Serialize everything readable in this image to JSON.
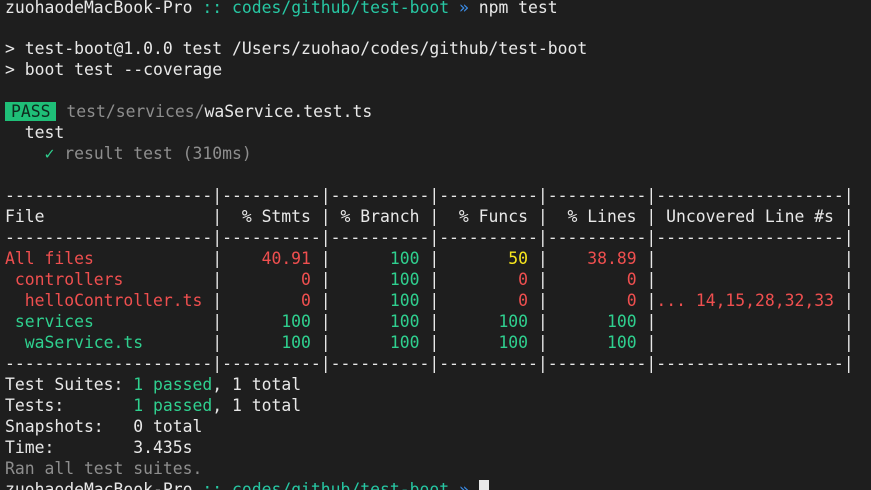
{
  "prompt": {
    "host": "zuohaodeMacBook-Pro",
    "sep": " :: ",
    "path": "codes/github/test-boot",
    "arrow": " » ",
    "command": "npm test"
  },
  "npm_output": {
    "line1": "> test-boot@1.0.0 test /Users/zuohao/codes/github/test-boot",
    "line2": "> boot test --coverage"
  },
  "result": {
    "badge": "PASS",
    "file_dir": "test/services/",
    "file_name": "waService.test.ts",
    "suite": "test",
    "check": "✓",
    "test_name": "result test (310ms)"
  },
  "coverage": {
    "separator": "---------------------|----------|----------|----------|----------|-------------------|",
    "header": "File                 |  % Stmts | % Branch |  % Funcs |  % Lines | Uncovered Line #s |",
    "rows": [
      {
        "file": "All files",
        "stmts": "40.91",
        "branch": "100",
        "funcs": "50",
        "lines": "38.89",
        "uncovered": ""
      },
      {
        "file": " controllers",
        "stmts": "0",
        "branch": "100",
        "funcs": "0",
        "lines": "0",
        "uncovered": ""
      },
      {
        "file": "  helloController.ts",
        "stmts": "0",
        "branch": "100",
        "funcs": "0",
        "lines": "0",
        "uncovered": "... 14,15,28,32,33"
      },
      {
        "file": " services",
        "stmts": "100",
        "branch": "100",
        "funcs": "100",
        "lines": "100",
        "uncovered": ""
      },
      {
        "file": "  waService.ts",
        "stmts": "100",
        "branch": "100",
        "funcs": "100",
        "lines": "100",
        "uncovered": ""
      }
    ]
  },
  "summary": {
    "suites_label": "Test Suites: ",
    "suites_passed": "1 passed",
    "suites_total": ", 1 total",
    "tests_label": "Tests:       ",
    "tests_passed": "1 passed",
    "tests_total": ", 1 total",
    "snapshots": "Snapshots:   0 total",
    "time": "Time:        3.435s",
    "ran": "Ran all test suites."
  }
}
